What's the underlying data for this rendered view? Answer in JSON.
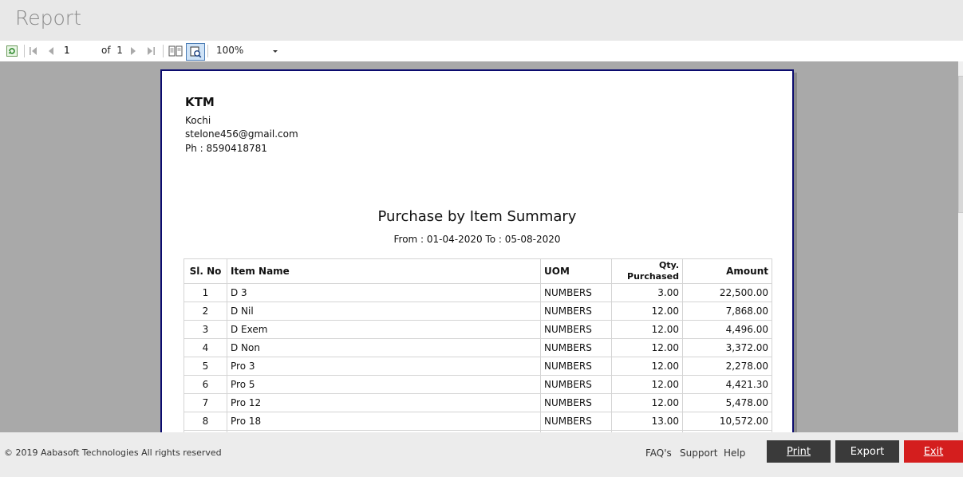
{
  "window": {
    "title": "Report"
  },
  "toolbar": {
    "page_current": "1",
    "of_label": "of",
    "page_total": "1",
    "zoom": "100%"
  },
  "company": {
    "name": "KTM",
    "city": "Kochi",
    "email": "stelone456@gmail.com",
    "phone": "Ph : 8590418781"
  },
  "report": {
    "title": "Purchase by Item Summary",
    "subtitle": "From : 01-04-2020 To : 05-08-2020",
    "columns": [
      "Sl. No",
      "Item Name",
      "UOM",
      "Qty. Purchased",
      "Amount"
    ],
    "rows": [
      [
        "1",
        "D 3",
        "NUMBERS",
        "3.00",
        "22,500.00"
      ],
      [
        "2",
        "D Nil",
        "NUMBERS",
        "12.00",
        "7,868.00"
      ],
      [
        "3",
        "D Exem",
        "NUMBERS",
        "12.00",
        "4,496.00"
      ],
      [
        "4",
        "D Non",
        "NUMBERS",
        "12.00",
        "3,372.00"
      ],
      [
        "5",
        "Pro 3",
        "NUMBERS",
        "12.00",
        "2,278.00"
      ],
      [
        "6",
        "Pro 5",
        "NUMBERS",
        "12.00",
        "4,421.30"
      ],
      [
        "7",
        "Pro 12",
        "NUMBERS",
        "12.00",
        "5,478.00"
      ],
      [
        "8",
        "Pro 18",
        "NUMBERS",
        "13.00",
        "10,572.00"
      ]
    ]
  },
  "footer": {
    "copyright": "© 2019 Aabasoft Technologies All rights reserved",
    "links": [
      "FAQ's",
      "Support",
      "Help"
    ],
    "print_label": "Print",
    "export_label": "Export",
    "exit_label": "Exit"
  },
  "colors": {
    "exit_button": "#d41e1e",
    "dark_button": "#3a3a3a",
    "page_border": "#0b0b6e",
    "viewer_bg": "#a9a9a9"
  },
  "icons": [
    "refresh-icon",
    "first-page-icon",
    "prev-page-icon",
    "next-page-icon",
    "last-page-icon",
    "print-layout-icon",
    "page-setup-icon"
  ]
}
